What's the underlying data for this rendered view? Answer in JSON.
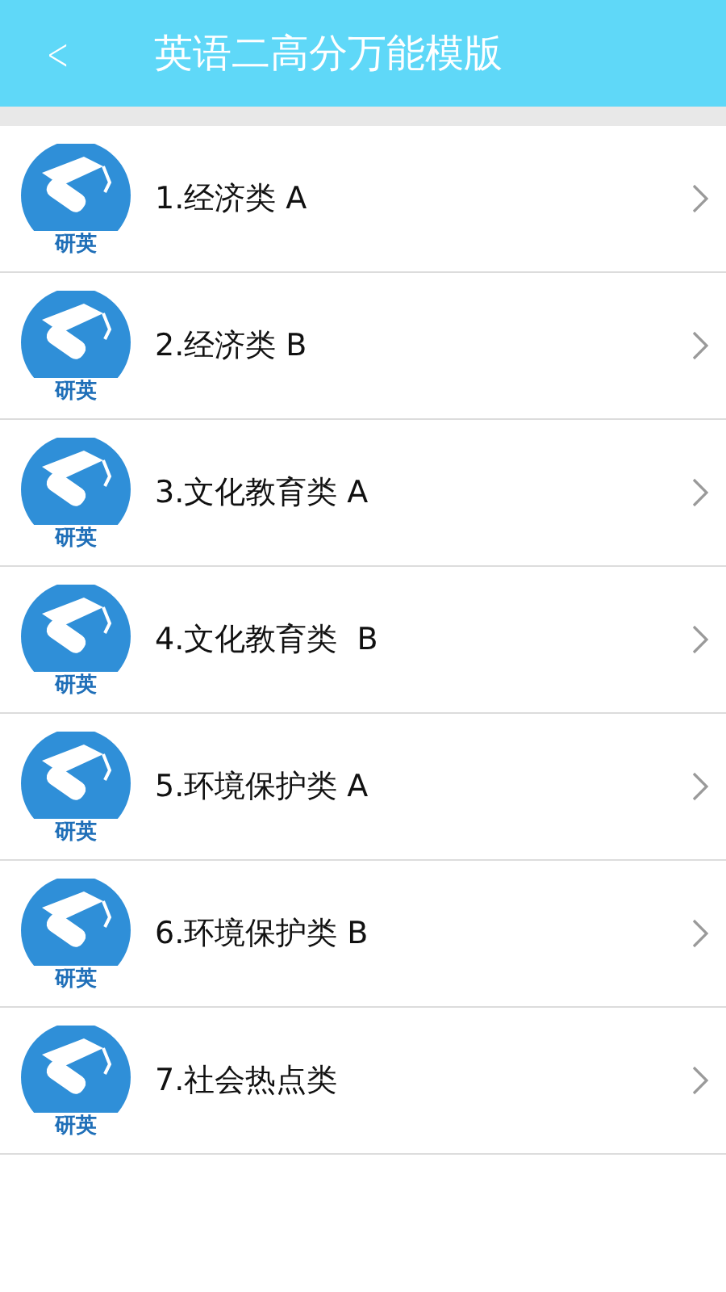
{
  "header": {
    "back": "<",
    "title": "英语二高分万能模版"
  },
  "items": [
    {
      "label": "1.经济类 A",
      "logo_text": "研英"
    },
    {
      "label": "2.经济类 B",
      "logo_text": "研英"
    },
    {
      "label": "3.文化教育类 A",
      "logo_text": "研英"
    },
    {
      "label": "4.文化教育类  B",
      "logo_text": "研英"
    },
    {
      "label": "5.环境保护类 A",
      "logo_text": "研英"
    },
    {
      "label": "6.环境保护类 B",
      "logo_text": "研英"
    },
    {
      "label": "7.社会热点类",
      "logo_text": "研英"
    }
  ]
}
